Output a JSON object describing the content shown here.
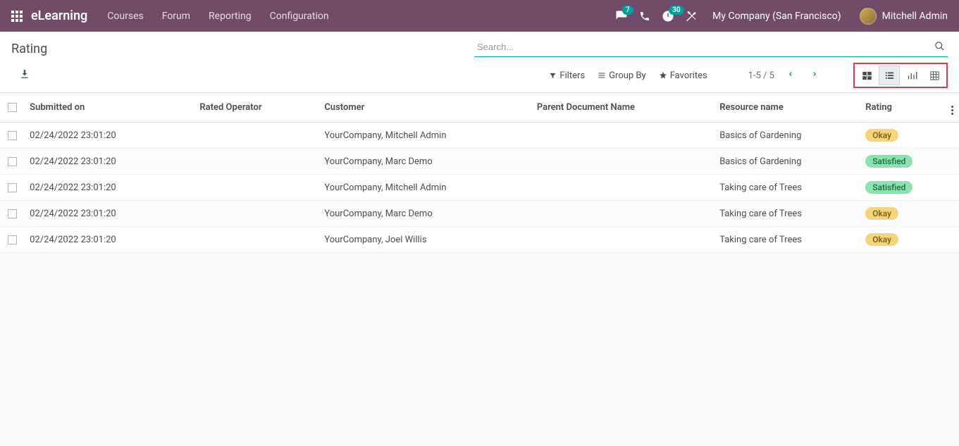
{
  "navbar": {
    "brand": "eLearning",
    "links": [
      "Courses",
      "Forum",
      "Reporting",
      "Configuration"
    ],
    "messages_badge": "7",
    "activities_badge": "30",
    "company": "My Company (San Francisco)",
    "user": "Mitchell Admin"
  },
  "page": {
    "title": "Rating",
    "search_placeholder": "Search...",
    "filters_label": "Filters",
    "groupby_label": "Group By",
    "favorites_label": "Favorites",
    "pager": "1-5 / 5"
  },
  "columns": {
    "submitted": "Submitted on",
    "operator": "Rated Operator",
    "customer": "Customer",
    "parent": "Parent Document Name",
    "resource": "Resource name",
    "rating": "Rating"
  },
  "rows": [
    {
      "submitted": "02/24/2022 23:01:20",
      "operator": "",
      "customer": "YourCompany, Mitchell Admin",
      "parent": "",
      "resource": "Basics of Gardening",
      "rating": "Okay",
      "rating_class": "okay"
    },
    {
      "submitted": "02/24/2022 23:01:20",
      "operator": "",
      "customer": "YourCompany, Marc Demo",
      "parent": "",
      "resource": "Basics of Gardening",
      "rating": "Satisfied",
      "rating_class": "satisfied"
    },
    {
      "submitted": "02/24/2022 23:01:20",
      "operator": "",
      "customer": "YourCompany, Mitchell Admin",
      "parent": "",
      "resource": "Taking care of Trees",
      "rating": "Satisfied",
      "rating_class": "satisfied"
    },
    {
      "submitted": "02/24/2022 23:01:20",
      "operator": "",
      "customer": "YourCompany, Marc Demo",
      "parent": "",
      "resource": "Taking care of Trees",
      "rating": "Okay",
      "rating_class": "okay"
    },
    {
      "submitted": "02/24/2022 23:01:20",
      "operator": "",
      "customer": "YourCompany, Joel Willis",
      "parent": "",
      "resource": "Taking care of Trees",
      "rating": "Okay",
      "rating_class": "okay"
    }
  ]
}
